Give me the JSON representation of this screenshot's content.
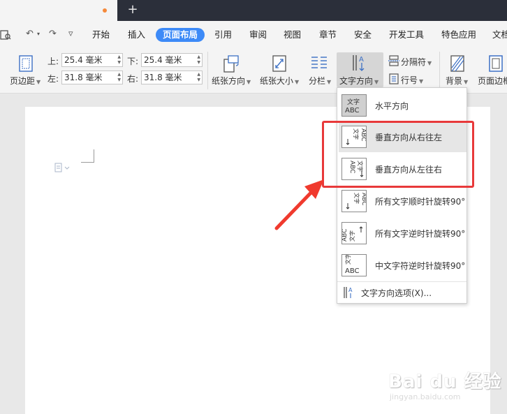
{
  "quick_access": {
    "undo": "↶",
    "redo": "↷",
    "customize": "▿"
  },
  "menu": {
    "items": [
      "开始",
      "插入",
      "页面布局",
      "引用",
      "审阅",
      "视图",
      "章节",
      "安全",
      "开发工具",
      "特色应用",
      "文档"
    ],
    "active": "页面布局"
  },
  "ribbon": {
    "margins": "页边距",
    "top_label": "上:",
    "top_value": "25.4 毫米",
    "bottom_label": "下:",
    "bottom_value": "25.4 毫米",
    "left_label": "左:",
    "left_value": "31.8 毫米",
    "right_label": "右:",
    "right_value": "31.8 毫米",
    "orientation": "纸张方向",
    "paper_size": "纸张大小",
    "columns": "分栏",
    "text_direction": "文字方向",
    "separator": "分隔符",
    "line_numbers": "行号",
    "background": "背景",
    "page_border": "页面边框"
  },
  "dropdown": {
    "items": [
      {
        "label": "水平方向",
        "thumb": [
          "文字",
          "ABC"
        ]
      },
      {
        "label": "垂直方向从右往左",
        "thumb": [
          "ABC",
          "文字"
        ]
      },
      {
        "label": "垂直方向从左往右",
        "thumb": [
          "ABC",
          "文字"
        ]
      },
      {
        "label": "所有文字顺时针旋转90°",
        "thumb": [
          "ABC",
          "文字"
        ]
      },
      {
        "label": "所有文字逆时针旋转90°",
        "thumb": [
          "ABC",
          "文字"
        ]
      },
      {
        "label": "中文字符逆时针旋转90°",
        "thumb": [
          "文字",
          "ABC"
        ]
      }
    ],
    "options_label": "文字方向选项(X)..."
  },
  "watermark": {
    "brand": "Bai du 经验",
    "url": "jingyan.baidu.com"
  },
  "colors": {
    "accent": "#3d8af7",
    "highlight": "#e8393a",
    "titlebar": "#2b2f3a"
  }
}
